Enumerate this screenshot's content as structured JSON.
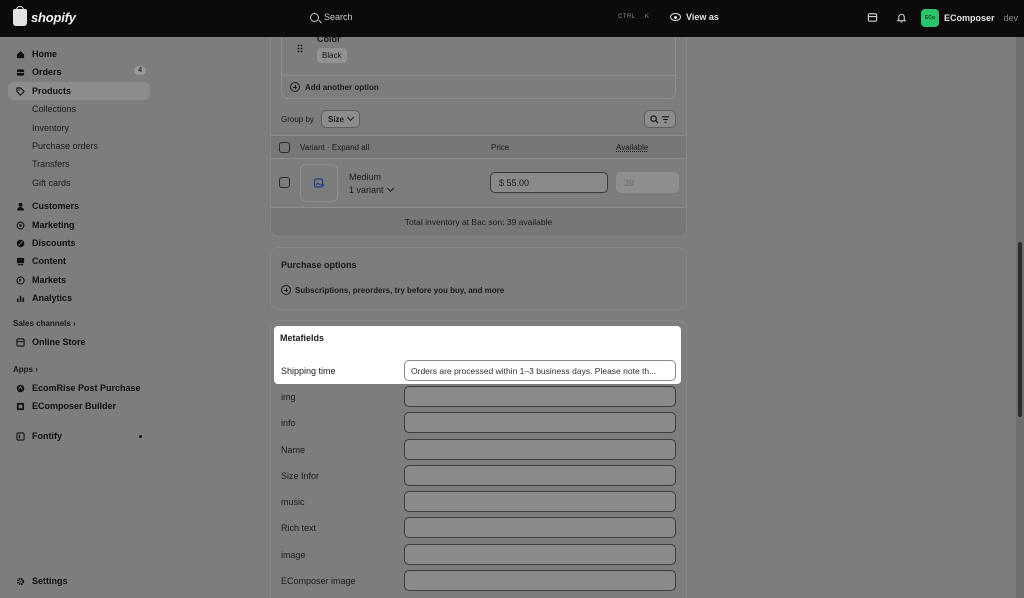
{
  "topbar": {
    "brand": "shopify",
    "search_placeholder": "Search",
    "shortcut_ctrl": "CTRL",
    "shortcut_key": "K",
    "view_as": "View as",
    "avatar_initials": "ECo",
    "store_name": "EComposer",
    "store_suffix": "dev"
  },
  "sidebar": {
    "home": "Home",
    "orders": "Orders",
    "orders_badge": "4",
    "products": "Products",
    "collections": "Collections",
    "inventory": "Inventory",
    "purchase_orders": "Purchase orders",
    "transfers": "Transfers",
    "gift_cards": "Gift cards",
    "customers": "Customers",
    "marketing": "Marketing",
    "discounts": "Discounts",
    "content": "Content",
    "markets": "Markets",
    "analytics": "Analytics",
    "sales_channels": "Sales channels ›",
    "online_store": "Online Store",
    "apps": "Apps ›",
    "app_ecomrise": "EcomRise Post Purchase",
    "app_ecomposer": "EComposer Builder",
    "fontify": "Fontify",
    "settings": "Settings"
  },
  "variants": {
    "option_name": "Color",
    "option_value": "Black",
    "add_option": "Add another option",
    "group_by_label": "Group by",
    "group_by_value": "Size",
    "col_variant": "Variant · Expand all",
    "col_price": "Price",
    "col_available": "Available",
    "row": {
      "name": "Medium",
      "count": "1 variant",
      "price": "$ 55.00",
      "available": "39"
    },
    "total_inventory": "Total inventory at Bac son: 39 available"
  },
  "purchase_options": {
    "title": "Purchase options",
    "link": "Subscriptions, preorders, try before you buy, and more"
  },
  "metafields": {
    "title": "Metafields",
    "rows": [
      {
        "label": "Shipping time",
        "value": "Orders are processed within 1–3 business days. Please note th..."
      },
      {
        "label": "img",
        "value": ""
      },
      {
        "label": "info",
        "value": ""
      },
      {
        "label": "Name",
        "value": ""
      },
      {
        "label": "Size Infor",
        "value": ""
      },
      {
        "label": "music",
        "value": ""
      },
      {
        "label": "Rich text",
        "value": ""
      },
      {
        "label": "image",
        "value": ""
      },
      {
        "label": "EComposer image",
        "value": ""
      }
    ]
  },
  "colors": {
    "topbar": "#0b0b0b",
    "overlay": "#7d7d7d",
    "highlight": "#ffffff",
    "avatar": "#29c46c"
  }
}
